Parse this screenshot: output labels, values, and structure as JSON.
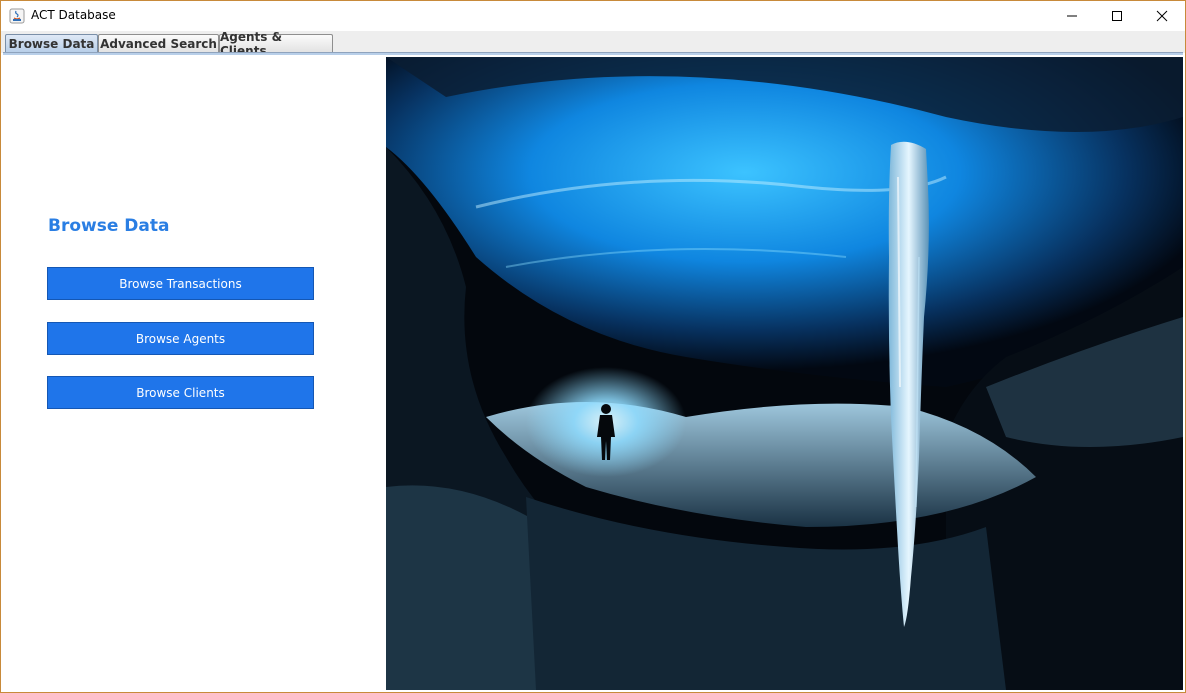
{
  "window": {
    "title": "ACT Database",
    "controls": {
      "minimize": "minimize",
      "maximize": "maximize",
      "close": "close"
    }
  },
  "tabs": [
    {
      "label": "Browse Data",
      "active": true
    },
    {
      "label": "Advanced Search",
      "active": false
    },
    {
      "label": "Agents & Clients",
      "active": false
    }
  ],
  "browse": {
    "heading": "Browse Data",
    "buttons": {
      "transactions": "Browse Transactions",
      "agents": "Browse Agents",
      "clients": "Browse Clients"
    }
  },
  "image": {
    "subject": "ice cave photograph with explorer and icicle"
  },
  "colors": {
    "accent": "#2a7ee3",
    "button": "#1f75ea",
    "ice": "#1fa3ff"
  }
}
